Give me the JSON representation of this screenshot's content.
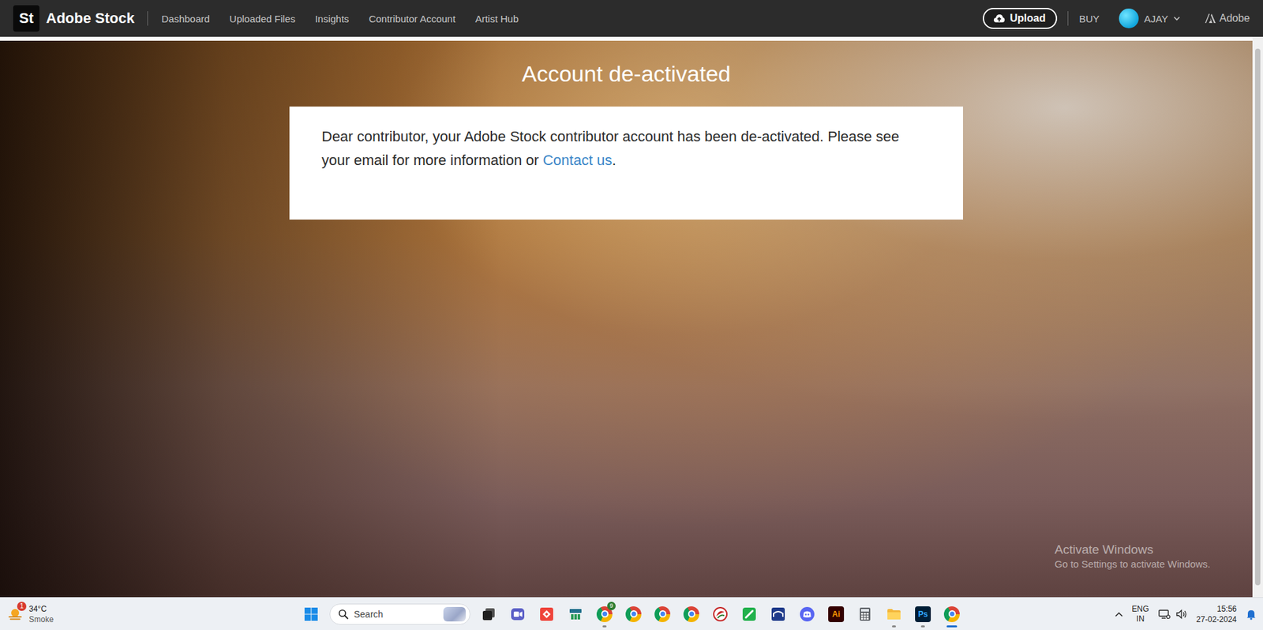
{
  "nav": {
    "logo": "St",
    "brand": "Adobe Stock",
    "links": [
      {
        "label": "Dashboard",
        "selected": false
      },
      {
        "label": "Uploaded Files",
        "selected": false
      },
      {
        "label": "Insights",
        "selected": false
      },
      {
        "label": "Contributor Account",
        "selected": false
      },
      {
        "label": "Artist Hub",
        "selected": false
      }
    ],
    "upload": "Upload",
    "buy": "BUY",
    "user": "AJAY",
    "adobe": "Adobe"
  },
  "page": {
    "title": "Account de-activated",
    "message": "Dear contributor, your Adobe Stock contributor account has been de-activated. Please see your email for more information or ",
    "link": "Contact us",
    "end": "."
  },
  "watermark": {
    "title": "Activate Windows",
    "subtitle": "Go to Settings to activate Windows."
  },
  "taskbar": {
    "weather": {
      "temp": "34°C",
      "condition": "Smoke",
      "badge": "1"
    },
    "search": {
      "placeholder": "Search"
    },
    "apps": [
      {
        "kind": "taskview",
        "running": false,
        "active": false
      },
      {
        "kind": "chat",
        "running": false,
        "active": false
      },
      {
        "kind": "anydesk",
        "running": false,
        "active": false
      },
      {
        "kind": "network",
        "running": false,
        "active": false
      },
      {
        "kind": "chrome",
        "running": true,
        "active": false,
        "badge": "9"
      },
      {
        "kind": "chrome",
        "running": false,
        "active": false
      },
      {
        "kind": "chrome",
        "running": false,
        "active": false
      },
      {
        "kind": "chrome",
        "running": false,
        "active": false
      },
      {
        "kind": "corel",
        "running": false,
        "active": false
      },
      {
        "kind": "green",
        "running": false,
        "active": false
      },
      {
        "kind": "bridge",
        "running": false,
        "active": false
      },
      {
        "kind": "discord",
        "running": false,
        "active": false
      },
      {
        "kind": "illustrator",
        "running": false,
        "active": false,
        "label": "Ai"
      },
      {
        "kind": "calculator",
        "running": false,
        "active": false
      },
      {
        "kind": "explorer",
        "running": true,
        "active": false
      },
      {
        "kind": "photoshop",
        "running": true,
        "active": false,
        "label": "Ps"
      },
      {
        "kind": "chrome",
        "running": true,
        "active": true
      }
    ],
    "tray": {
      "language": "ENG",
      "region": "IN",
      "time": "15:56",
      "date": "27-02-2024"
    }
  }
}
